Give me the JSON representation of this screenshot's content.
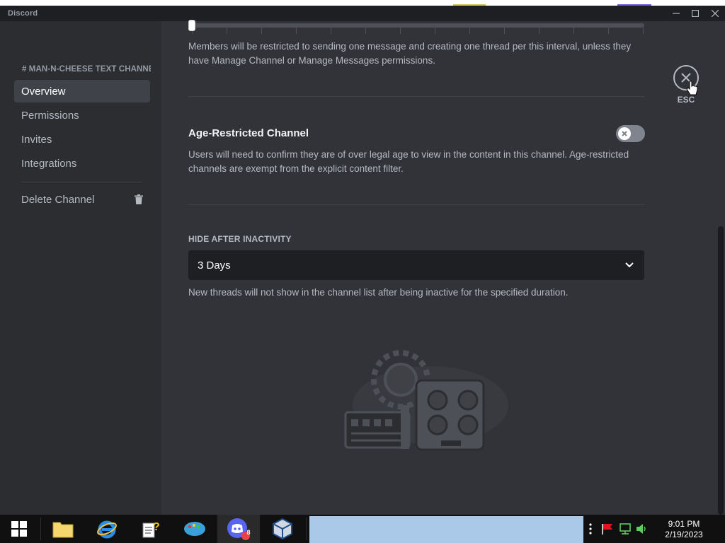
{
  "window": {
    "app_name": "Discord"
  },
  "sidebar": {
    "channel_header": "# MAN-N-CHEESE TEXT CHANNELS",
    "items": [
      {
        "label": "Overview",
        "active": true
      },
      {
        "label": "Permissions",
        "active": false
      },
      {
        "label": "Invites",
        "active": false
      },
      {
        "label": "Integrations",
        "active": false
      }
    ],
    "delete_label": "Delete Channel"
  },
  "slowmode": {
    "description_line1": "Members will be restricted to sending one message and creating one thread per this interval, unless they",
    "description_line2": "have Manage Channel or Manage Messages permissions."
  },
  "age_restricted": {
    "title": "Age-Restricted Channel",
    "enabled": false,
    "description_line1": "Users will need to confirm they are of over legal age to view in the content in this channel. Age-restricted",
    "description_line2": "channels are exempt from the explicit content filter."
  },
  "hide_after_inactivity": {
    "label": "HIDE AFTER INACTIVITY",
    "selected": "3 Days",
    "description": "New threads will not show in the channel list after being inactive for the specified duration."
  },
  "close": {
    "esc_label": "ESC"
  },
  "taskbar": {
    "time": "9:01 PM",
    "date": "2/19/2023",
    "discord_badge": "8"
  },
  "colors": {
    "accent": "#5865f2",
    "background": "#313338",
    "sidebar": "#2b2d31",
    "taskbar": "#101010"
  }
}
